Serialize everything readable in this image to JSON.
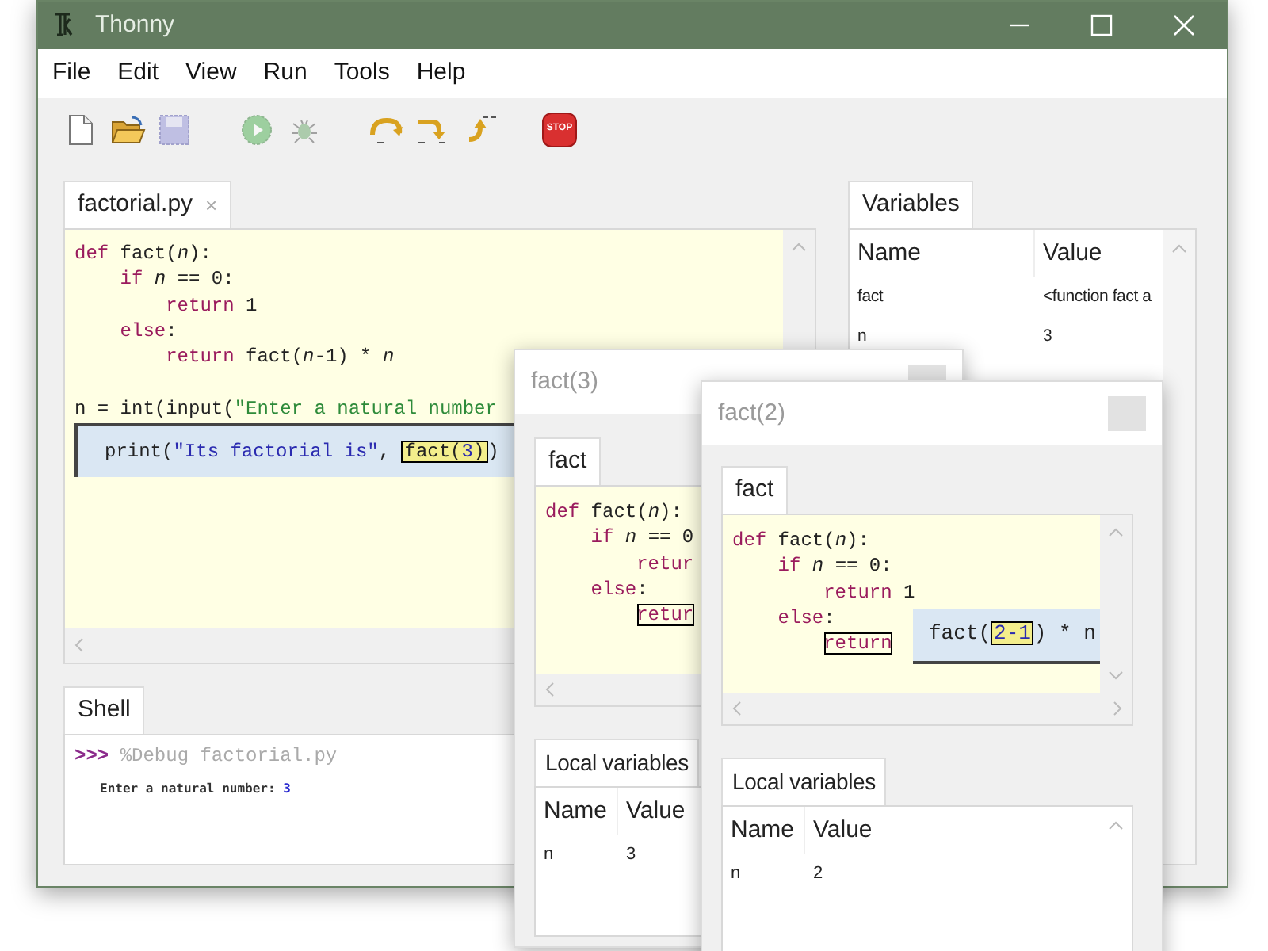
{
  "window": {
    "title": "Thonny"
  },
  "menu": [
    "File",
    "Edit",
    "View",
    "Run",
    "Tools",
    "Help"
  ],
  "toolbar": [
    {
      "kind": "new",
      "disabled": false
    },
    {
      "kind": "open",
      "disabled": false
    },
    {
      "kind": "save",
      "disabled": true
    },
    {
      "kind": "run",
      "disabled": true
    },
    {
      "kind": "debug",
      "disabled": true
    },
    {
      "kind": "step_over",
      "disabled": false
    },
    {
      "kind": "step_into",
      "disabled": false
    },
    {
      "kind": "step_out",
      "disabled": false
    },
    {
      "kind": "stop",
      "disabled": false,
      "label": "STOP"
    }
  ],
  "editor": {
    "tab": {
      "label": "factorial.py",
      "close": "×",
      "selected": true
    },
    "lines": [
      {
        "kind": "code",
        "tokens": [
          {
            "kind": "kw",
            "text": "def"
          },
          {
            "kind": "plain",
            "text": " fact("
          },
          {
            "kind": "param",
            "text": "n"
          },
          {
            "kind": "plain",
            "text": "):"
          }
        ]
      },
      {
        "kind": "code",
        "tokens": [
          {
            "kind": "kw",
            "text": "    if "
          },
          {
            "kind": "param",
            "text": "n"
          },
          {
            "kind": "plain",
            "text": " == 0:"
          }
        ]
      },
      {
        "kind": "code",
        "tokens": [
          {
            "kind": "kw",
            "text": "        return"
          },
          {
            "kind": "plain",
            "text": " 1"
          }
        ]
      },
      {
        "kind": "code",
        "tokens": [
          {
            "kind": "kw",
            "text": "    else"
          },
          {
            "kind": "plain",
            "text": ":"
          }
        ]
      },
      {
        "kind": "code",
        "tokens": [
          {
            "kind": "kw",
            "text": "        return"
          },
          {
            "kind": "plain",
            "text": " fact("
          },
          {
            "kind": "param",
            "text": "n"
          },
          {
            "kind": "plain",
            "text": "-1) * "
          },
          {
            "kind": "param",
            "text": "n"
          }
        ]
      },
      {
        "kind": "blank"
      },
      {
        "kind": "code",
        "tokens": [
          {
            "kind": "plain",
            "text": "n = int(input("
          },
          {
            "kind": "str",
            "text": "\"Enter a natural number"
          }
        ]
      }
    ],
    "popup": [
      {
        "kind": "plain",
        "text": "print("
      },
      {
        "kind": "val",
        "text": "\"Its factorial is\""
      },
      {
        "kind": "plain",
        "text": ", "
      },
      {
        "kind": "focus",
        "parts": [
          {
            "kind": "plain",
            "text": "fact("
          },
          {
            "kind": "val",
            "text": "3"
          },
          {
            "kind": "plain",
            "text": ")"
          }
        ]
      },
      {
        "kind": "plain",
        "text": ")"
      }
    ]
  },
  "shell": {
    "tab": {
      "label": "Shell",
      "selected": true
    },
    "prompt": ">>>",
    "command": "%Debug factorial.py",
    "output": "Enter a natural number: ",
    "input": "3"
  },
  "variables": {
    "tab": {
      "label": "Variables",
      "selected": true
    },
    "columns": [
      "Name",
      "Value"
    ],
    "rows": [
      [
        "fact",
        "<function fact a"
      ],
      [
        "n",
        "3"
      ]
    ]
  },
  "frames": [
    {
      "title": "fact(3)",
      "tab": {
        "label": "fact",
        "selected": true
      },
      "lines": [
        {
          "kind": "code",
          "tokens": [
            {
              "kind": "kw",
              "text": "def"
            },
            {
              "kind": "plain",
              "text": " fact("
            },
            {
              "kind": "param",
              "text": "n"
            },
            {
              "kind": "plain",
              "text": "):"
            }
          ]
        },
        {
          "kind": "code",
          "tokens": [
            {
              "kind": "kw",
              "text": "    if "
            },
            {
              "kind": "param",
              "text": "n"
            },
            {
              "kind": "plain",
              "text": " == 0"
            }
          ]
        },
        {
          "kind": "code",
          "tokens": [
            {
              "kind": "kw",
              "text": "        retur"
            }
          ]
        },
        {
          "kind": "code",
          "tokens": [
            {
              "kind": "kw",
              "text": "    else"
            },
            {
              "kind": "plain",
              "text": ":"
            }
          ]
        },
        {
          "kind": "code",
          "tokens": [
            {
              "kind": "stmt",
              "text": "        retur"
            }
          ]
        }
      ],
      "locals_tab": {
        "label": "Local variables",
        "selected": true
      },
      "columns": [
        "Name",
        "Value"
      ],
      "rows": [
        [
          "n",
          "3"
        ]
      ]
    },
    {
      "title": "fact(2)",
      "tab": {
        "label": "fact",
        "selected": true
      },
      "lines": [
        {
          "kind": "code",
          "tokens": [
            {
              "kind": "kw",
              "text": "def"
            },
            {
              "kind": "plain",
              "text": " fact("
            },
            {
              "kind": "param",
              "text": "n"
            },
            {
              "kind": "plain",
              "text": "):"
            }
          ]
        },
        {
          "kind": "code",
          "tokens": [
            {
              "kind": "kw",
              "text": "    if "
            },
            {
              "kind": "param",
              "text": "n"
            },
            {
              "kind": "plain",
              "text": " == 0:"
            }
          ]
        },
        {
          "kind": "code",
          "tokens": [
            {
              "kind": "kw",
              "text": "        return"
            },
            {
              "kind": "plain",
              "text": " 1"
            }
          ]
        },
        {
          "kind": "code",
          "tokens": [
            {
              "kind": "kw",
              "text": "    else"
            },
            {
              "kind": "plain",
              "text": ":"
            }
          ]
        },
        {
          "kind": "code",
          "tokens": [
            {
              "kind": "stmt",
              "text": "        return"
            }
          ]
        }
      ],
      "popup": [
        {
          "kind": "plain",
          "text": "fact("
        },
        {
          "kind": "focus",
          "parts": [
            {
              "kind": "val",
              "text": "2-1"
            }
          ]
        },
        {
          "kind": "plain",
          "text": ") * n"
        }
      ],
      "locals_tab": {
        "label": "Local variables",
        "selected": true
      },
      "columns": [
        "Name",
        "Value"
      ],
      "rows": [
        [
          "n",
          "2"
        ]
      ]
    }
  ]
}
